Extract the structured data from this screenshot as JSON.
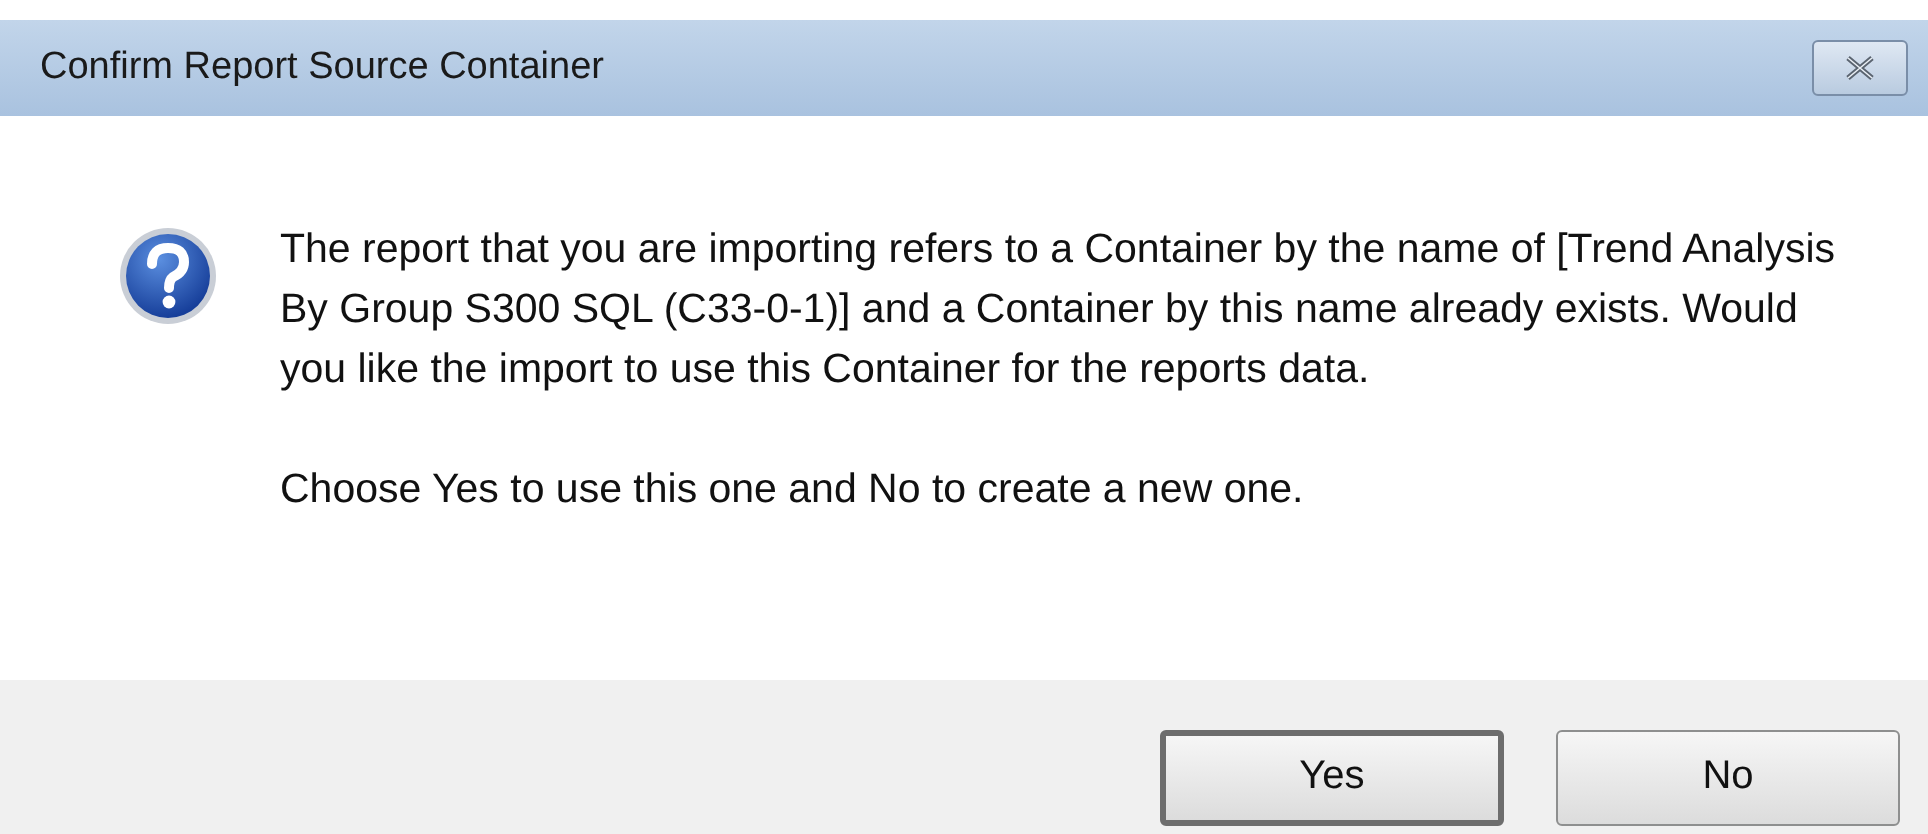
{
  "window": {
    "title": "Confirm Report Source Container"
  },
  "message": {
    "paragraphs": [
      "The report that you are importing refers to a Container by the name of [Trend Analysis By Group S300 SQL (C33-0-1)] and a Container by this name already exists. Would you like the import to use this Container for the reports data.",
      "Choose Yes to use this one and No to create a new one."
    ]
  },
  "buttons": [
    {
      "label": "Yes",
      "default": true
    },
    {
      "label": "No",
      "default": false
    }
  ]
}
